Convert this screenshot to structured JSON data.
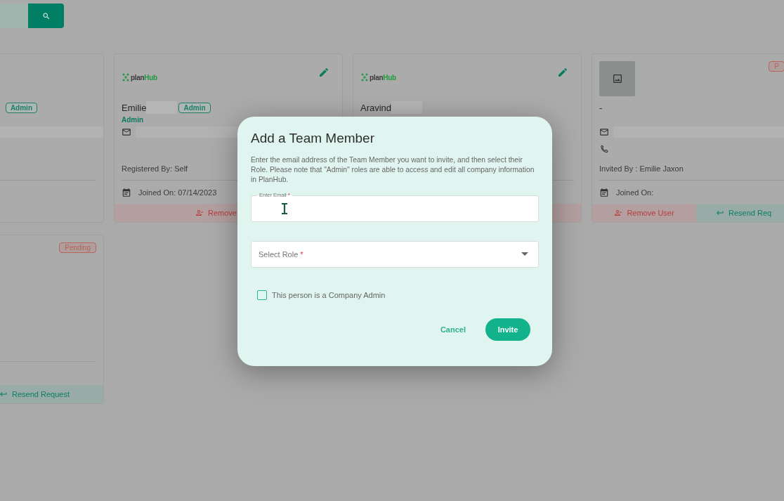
{
  "cards": [
    {
      "kind": "cropped",
      "badges": [
        {
          "label": "Admin",
          "kind": "role"
        }
      ],
      "email_redacted": true
    },
    {
      "kind": "member",
      "logo": [
        "plan",
        "Hub"
      ],
      "editable": true,
      "name": "Emilie",
      "name_redacted": true,
      "badges": [
        {
          "label": "Admin",
          "kind": "role"
        }
      ],
      "role": "Admin",
      "email_redacted": true,
      "meta": "Registered By: Self",
      "joined": "Joined On: 07/14/2023",
      "actions": [
        {
          "label": "Remove",
          "kind": "remove"
        }
      ]
    },
    {
      "kind": "member",
      "logo": [
        "plan",
        "Hub"
      ],
      "editable": true,
      "name": "Aravind",
      "name_redacted": true,
      "actions": [
        {
          "kind": "remove"
        }
      ]
    },
    {
      "kind": "member",
      "image_placeholder": true,
      "status": "P",
      "name": "-",
      "email_redacted": true,
      "phone": true,
      "meta": "Invited By : Emilie Jaxon",
      "joined": "Joined On:",
      "actions": [
        {
          "label": "Remove User",
          "kind": "remove"
        },
        {
          "label": "Resend Req",
          "kind": "resend"
        }
      ]
    },
    {
      "kind": "cropped",
      "status": "Pending",
      "actions": [
        {
          "kind": "spacer"
        },
        {
          "label": "Resend Request",
          "kind": "resend"
        }
      ]
    }
  ],
  "dialog": {
    "title": "Add a Team Member",
    "description": "Enter the email address of the Team Member you want to invite, and then select their Role. Please note that \"Admin\" roles are able to access and edit all company information in PlanHub.",
    "email": {
      "label": "Enter Email",
      "required_mark": "*"
    },
    "role": {
      "placeholder": "Select Role",
      "required_mark": "*"
    },
    "admin_checkbox": {
      "label": "This person is a Company Admin",
      "checked": false
    },
    "buttons": [
      {
        "label": "Cancel",
        "kind": "text"
      },
      {
        "label": "Invite",
        "kind": "primary"
      }
    ]
  }
}
